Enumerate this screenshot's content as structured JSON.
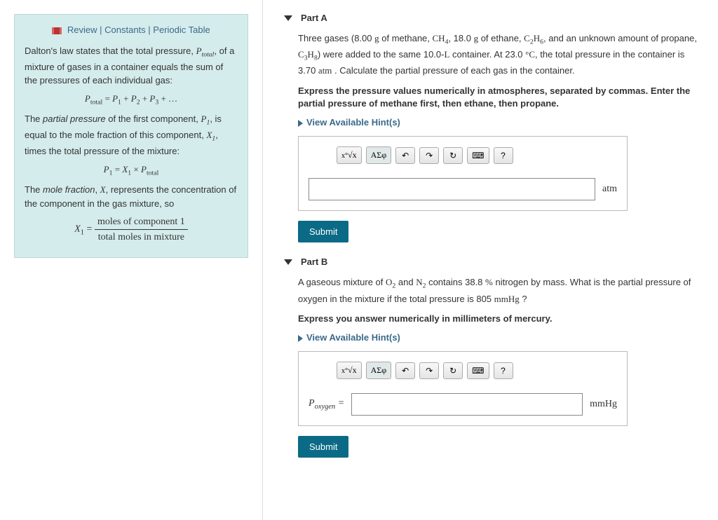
{
  "links": {
    "review": "Review",
    "constants": "Constants",
    "periodic": "Periodic Table",
    "sep": " | "
  },
  "intro": {
    "p1a": "Dalton's law states that the total pressure, ",
    "p1b": ", of a mixture of gases in a container equals the sum of the pressures of each individual gas:",
    "f1": "Ptotal = P1 + P2 + P3 + ...",
    "p2a": "The ",
    "p2b": "partial pressure",
    "p2c": " of the first component, ",
    "p2d": ", is equal to the mole fraction of this component, ",
    "p2e": ", times the total pressure of the mixture:",
    "f2": "P1 = X1 × Ptotal",
    "p3a": "The ",
    "p3b": "mole fraction",
    "p3c": ", ",
    "p3d": ", represents the concentration of the component in the gas mixture, so",
    "f3": "moles of component 1",
    "f3b": "total moles in mixture"
  },
  "partA": {
    "title": "Part A",
    "q1": "Three gases (8.00 g of methane, CH4, 18.0 g of ethane, C2H6, and an unknown amount of propane, C3H8) were added to the same 10.0-L container. At 23.0 °C, the total pressure in the container is 3.70 atm . Calculate the partial pressure of each gas in the container.",
    "inst": "Express the pressure values numerically in atmospheres, separated by commas. Enter the partial pressure of methane first, then ethane, then propane.",
    "hints": "View Available Hint(s)",
    "unit": "atm",
    "submit": "Submit"
  },
  "partB": {
    "title": "Part B",
    "q1": "A gaseous mixture of O2 and N2 contains 38.8 % nitrogen by mass. What is the partial pressure of oxygen in the mixture if the total pressure is 805 mmHg ?",
    "inst": "Express you answer numerically in millimeters of mercury.",
    "hints": "View Available Hint(s)",
    "prefix": "Poxygen =",
    "unit": "mmHg",
    "submit": "Submit"
  },
  "toolbar": {
    "templates": "√x",
    "greek": "ΑΣφ",
    "undo": "↶",
    "redo": "↷",
    "reset": "↻",
    "keyboard": "⌨",
    "help": "?"
  }
}
